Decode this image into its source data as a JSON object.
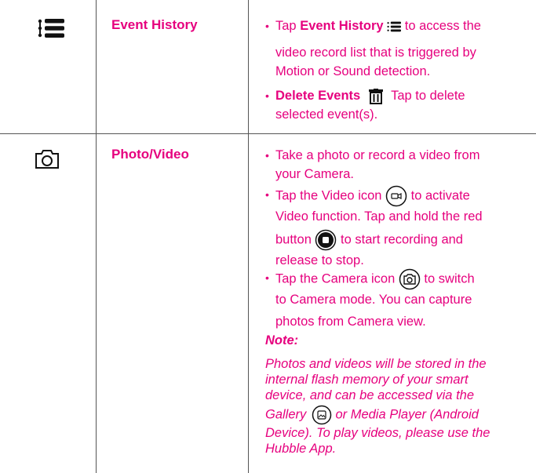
{
  "rows": [
    {
      "name": "Event History",
      "icon": "list-icon",
      "bullets": [
        {
          "pre": "Tap ",
          "bold": "Event History",
          "post": " to access the",
          "line2": "video record list that is triggered by",
          "line3": "Motion or Sound detection."
        },
        {
          "bold": "Delete Events",
          "post": " Tap to delete",
          "line2": "selected event(s)."
        }
      ]
    },
    {
      "name": "Photo/Video",
      "icon": "camera-icon",
      "bullets": [
        {
          "l1": "Take a photo or record a video from",
          "l2": "your Camera."
        },
        {
          "l1a": "Tap the Video icon ",
          "l1b": " to activate",
          "l2": "Video function. Tap and hold the red",
          "l3a": "button ",
          "l3b": " to start recording and",
          "l4": "release to stop."
        },
        {
          "l1a": "Tap the Camera icon ",
          "l1b": " to switch",
          "l2": "to Camera mode. You can capture",
          "l3": "photos from Camera view."
        }
      ],
      "note_title": "Note:",
      "note_lines": [
        "Photos and videos will be stored in the",
        "internal flash memory of your smart",
        "device, and can be accessed via the",
        "Gallery",
        " or Media Player (Android",
        "Device). To play videos, please use the",
        "Hubble App."
      ]
    }
  ],
  "colors": {
    "accent": "#e6007e",
    "rule": "#555555"
  }
}
